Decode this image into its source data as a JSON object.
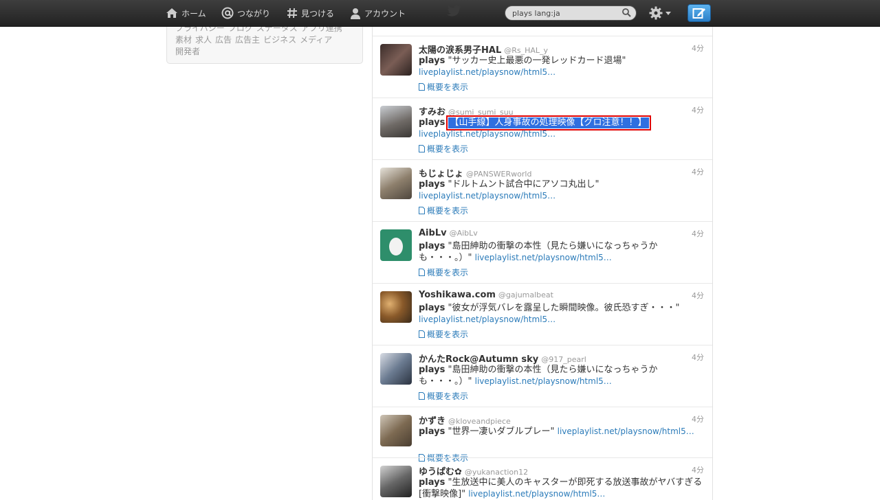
{
  "nav": {
    "home": "ホーム",
    "connect": "つながり",
    "discover": "見つける",
    "account": "アカウント"
  },
  "search": {
    "value": "plays lang:ja"
  },
  "footer": {
    "links": [
      "プライバシー",
      "ブログ",
      "ステータス",
      "アプリ連携",
      "素材",
      "求人",
      "広告",
      "広告主",
      "ビジネス",
      "メディア",
      "開発者"
    ]
  },
  "tweets": [
    {
      "name": "太陽の涙系男子HAL",
      "handle": "@Rs_HAL_y",
      "time": "4分",
      "prefix": "plays",
      "text": "\"サッカー史上最悪の一発レッドカード退場\"",
      "link": "liveplaylist.net/playsnow/html5…",
      "expand": "概要を表示"
    },
    {
      "name": "すみお",
      "handle": "@sumi_sumi_suu",
      "time": "4分",
      "prefix": "plays",
      "text": "【山手線】人身事故の処理映像【グロ注意！！】",
      "link": "liveplaylist.net/playsnow/html5…",
      "expand": "概要を表示"
    },
    {
      "name": "もじょじょ",
      "handle": "@PANSWERworld",
      "time": "4分",
      "prefix": "plays",
      "text": "\"ドルトムント試合中にアソコ丸出し\"",
      "link": "liveplaylist.net/playsnow/html5…",
      "expand": "概要を表示"
    },
    {
      "name": "AibLv",
      "handle": "@AibLv",
      "time": "4分",
      "prefix": "plays",
      "text": "\"島田紳助の衝撃の本性（見たら嫌いになっちゃうかも・・・。）\"",
      "link": "liveplaylist.net/playsnow/html5…",
      "expand": "概要を表示"
    },
    {
      "name": "Yoshikawa.com",
      "handle": "@gajumalbeat",
      "time": "4分",
      "prefix": "plays",
      "text": "\"彼女が浮気バレを露呈した瞬間映像。彼氏恐すぎ・・・\"",
      "link": "liveplaylist.net/playsnow/html5…",
      "expand": "概要を表示"
    },
    {
      "name": "かんたRock@Autumn sky",
      "handle": "@917_pearl",
      "time": "4分",
      "prefix": "plays",
      "text": "\"島田紳助の衝撃の本性（見たら嫌いになっちゃうかも・・・。）\"",
      "link": "liveplaylist.net/playsnow/html5…",
      "expand": "概要を表示"
    },
    {
      "name": "かずき",
      "handle": "@kloveandpiece",
      "time": "4分",
      "prefix": "plays",
      "text": "\"世界一凄いダブルプレー\"",
      "link": "liveplaylist.net/playsnow/html5…",
      "expand": "概要を表示"
    },
    {
      "name": "ゆうぱむ✿",
      "handle": "@yukanaction12",
      "time": "4分",
      "prefix": "plays",
      "text": "\"生放送中に美人のキャスターが即死する放送事故がヤバすぎる[衝撃映像]\"",
      "link": "liveplaylist.net/playsnow/html5…",
      "expand": ""
    }
  ]
}
